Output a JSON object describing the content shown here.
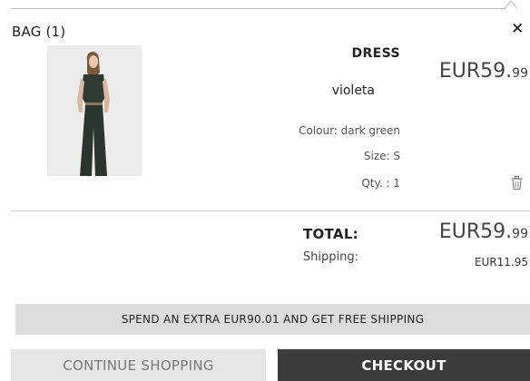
{
  "bag": {
    "title": "BAG (1)",
    "close_glyph": "✕"
  },
  "item": {
    "image": "dress-photo",
    "name": "DRESS",
    "brand": "violeta",
    "price_main": "EUR59.",
    "price_cents": "99",
    "colour": "Colour: dark green",
    "size": "Size: S",
    "qty": "Qty. : 1",
    "delete_icon": "trash-icon"
  },
  "summary": {
    "total_label": "TOTAL:",
    "total_main": "EUR59.",
    "total_cents": "99",
    "shipping_label": "Shipping:",
    "shipping_value": "EUR11.95"
  },
  "promo": {
    "text": "SPEND AN EXTRA EUR90.01 AND GET FREE SHIPPING"
  },
  "actions": {
    "continue_label": "CONTINUE SHOPPING",
    "checkout_label": "CHECKOUT"
  },
  "colors": {
    "checkout_bg": "#3b3b3b",
    "continue_bg": "#e6e6e6",
    "promo_bg": "#dcdcdc"
  }
}
